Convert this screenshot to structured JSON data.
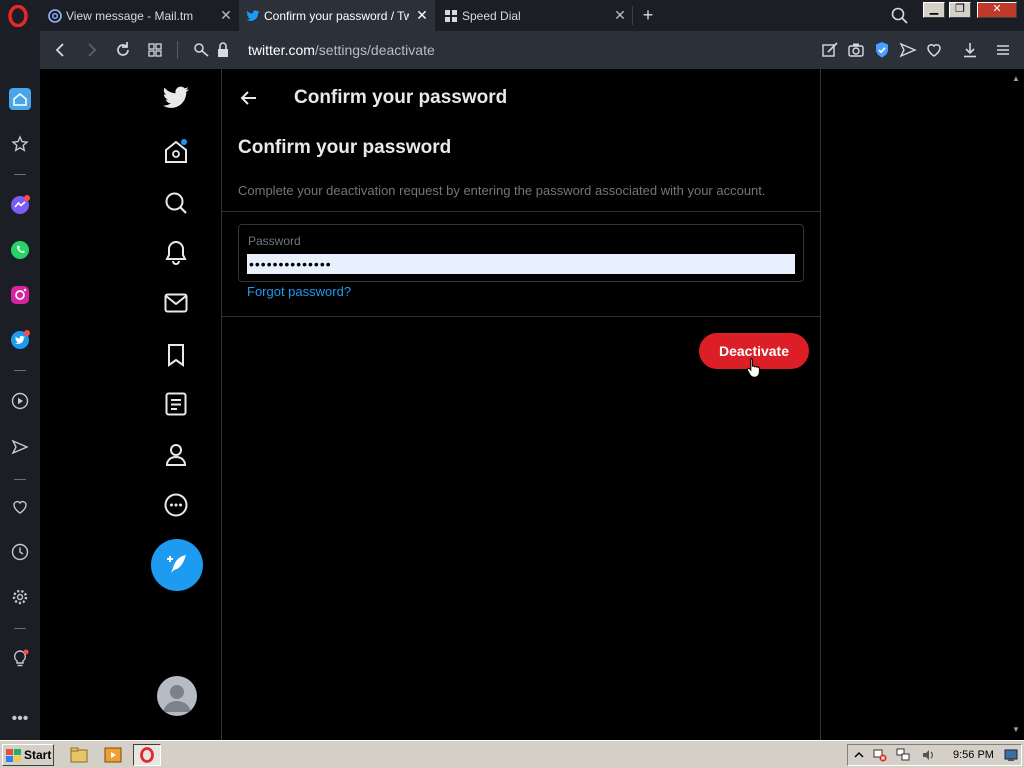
{
  "browser": {
    "tabs": [
      {
        "title": "View message - Mail.tm",
        "icon": "mailtm-icon",
        "active": false
      },
      {
        "title": "Confirm your password / Twi",
        "icon": "twitter-icon",
        "active": true
      },
      {
        "title": "Speed Dial",
        "icon": "speed-dial-icon",
        "active": false
      }
    ],
    "address": {
      "host": "twitter.com",
      "path": "/settings/deactivate"
    },
    "window_controls": [
      "minimize",
      "restore",
      "close"
    ]
  },
  "opera_sidebar": {
    "items": [
      "home-icon",
      "bookmarks-star-icon",
      "messenger-icon",
      "whatsapp-icon",
      "instagram-icon",
      "twitter-icon",
      "player-icon",
      "send-icon",
      "heart-icon",
      "history-icon",
      "settings-icon",
      "lightbulb-icon",
      "more-icon"
    ]
  },
  "twitter_nav": {
    "items": [
      "twitter-logo-icon",
      "home-icon",
      "explore-icon",
      "notifications-icon",
      "messages-icon",
      "bookmarks-icon",
      "lists-icon",
      "profile-icon",
      "more-icon"
    ],
    "compose_label": "Tweet"
  },
  "main": {
    "header_title": "Confirm your password",
    "section_title": "Confirm your password",
    "description": "Complete your deactivation request by entering the password associated with your account.",
    "password_label": "Password",
    "password_value": "••••••••••••••",
    "forgot_link": "Forgot password?",
    "deactivate_button": "Deactivate"
  },
  "taskbar": {
    "start_label": "Start",
    "clock": "9:56 PM"
  },
  "colors": {
    "accent": "#1d9bf0",
    "danger": "#dc1f26",
    "background": "#000000"
  }
}
